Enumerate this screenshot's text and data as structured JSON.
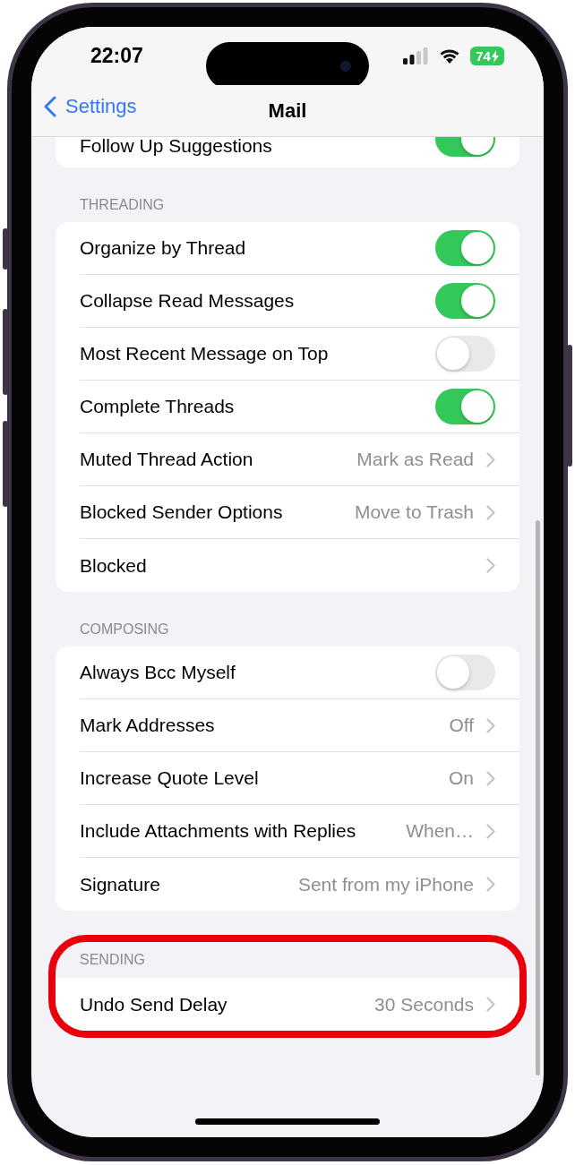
{
  "status_bar": {
    "time": "22:07",
    "battery": "74",
    "charging": true
  },
  "nav": {
    "back": "Settings",
    "title": "Mail"
  },
  "partial_row": {
    "label": "Follow Up Suggestions",
    "kind": "toggle",
    "on": true
  },
  "sections": [
    {
      "header": "THREADING",
      "highlighted": false,
      "rows": [
        {
          "kind": "toggle",
          "label": "Organize by Thread",
          "on": true
        },
        {
          "kind": "toggle",
          "label": "Collapse Read Messages",
          "on": true
        },
        {
          "kind": "toggle",
          "label": "Most Recent Message on Top",
          "on": false
        },
        {
          "kind": "toggle",
          "label": "Complete Threads",
          "on": true
        },
        {
          "kind": "link",
          "label": "Muted Thread Action",
          "value": "Mark as Read"
        },
        {
          "kind": "link",
          "label": "Blocked Sender Options",
          "value": "Move to Trash"
        },
        {
          "kind": "link",
          "label": "Blocked"
        }
      ]
    },
    {
      "header": "COMPOSING",
      "highlighted": false,
      "rows": [
        {
          "kind": "toggle",
          "label": "Always Bcc Myself",
          "on": false
        },
        {
          "kind": "link",
          "label": "Mark Addresses",
          "value": "Off"
        },
        {
          "kind": "link",
          "label": "Increase Quote Level",
          "value": "On"
        },
        {
          "kind": "link",
          "label": "Include Attachments with Replies",
          "value": "When…"
        },
        {
          "kind": "link",
          "label": "Signature",
          "value": "Sent from my iPhone"
        }
      ]
    },
    {
      "header": "SENDING",
      "highlighted": true,
      "rows": [
        {
          "kind": "link",
          "label": "Undo Send Delay",
          "value": "30 Seconds"
        }
      ]
    }
  ]
}
